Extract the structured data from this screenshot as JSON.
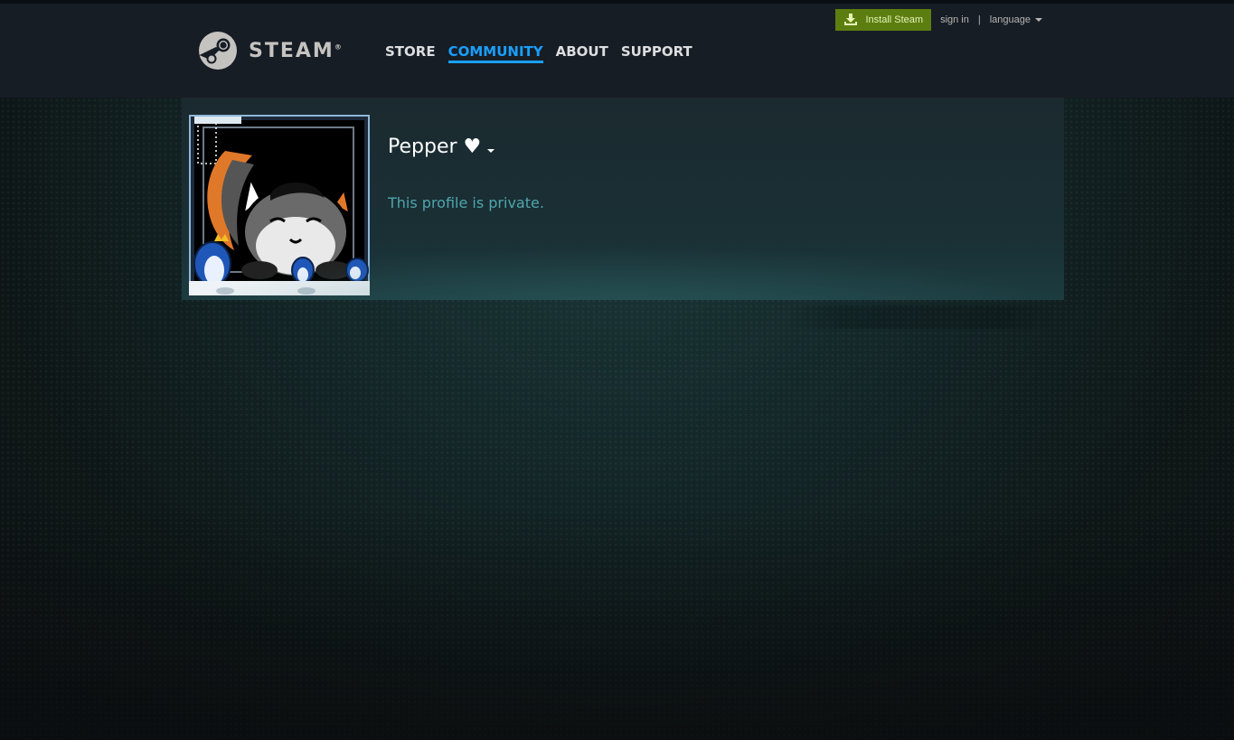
{
  "header": {
    "logo_text": "STEAM",
    "logo_mark": "®",
    "nav": [
      {
        "label": "STORE"
      },
      {
        "label": "COMMUNITY",
        "active": true
      },
      {
        "label": "ABOUT"
      },
      {
        "label": "SUPPORT"
      }
    ],
    "install_label": "Install Steam",
    "signin_label": "sign in",
    "separator": "|",
    "language_label": "language"
  },
  "profile": {
    "persona_name": "Pepper ♥",
    "private_message": "This profile is private."
  },
  "colors": {
    "accent_blue": "#1a9fff",
    "install_green": "#5c7e10",
    "private_text": "#4fa6ae"
  },
  "icons": [
    "steam-logo-icon",
    "download-icon",
    "language-caret-icon",
    "persona-caret-icon"
  ]
}
